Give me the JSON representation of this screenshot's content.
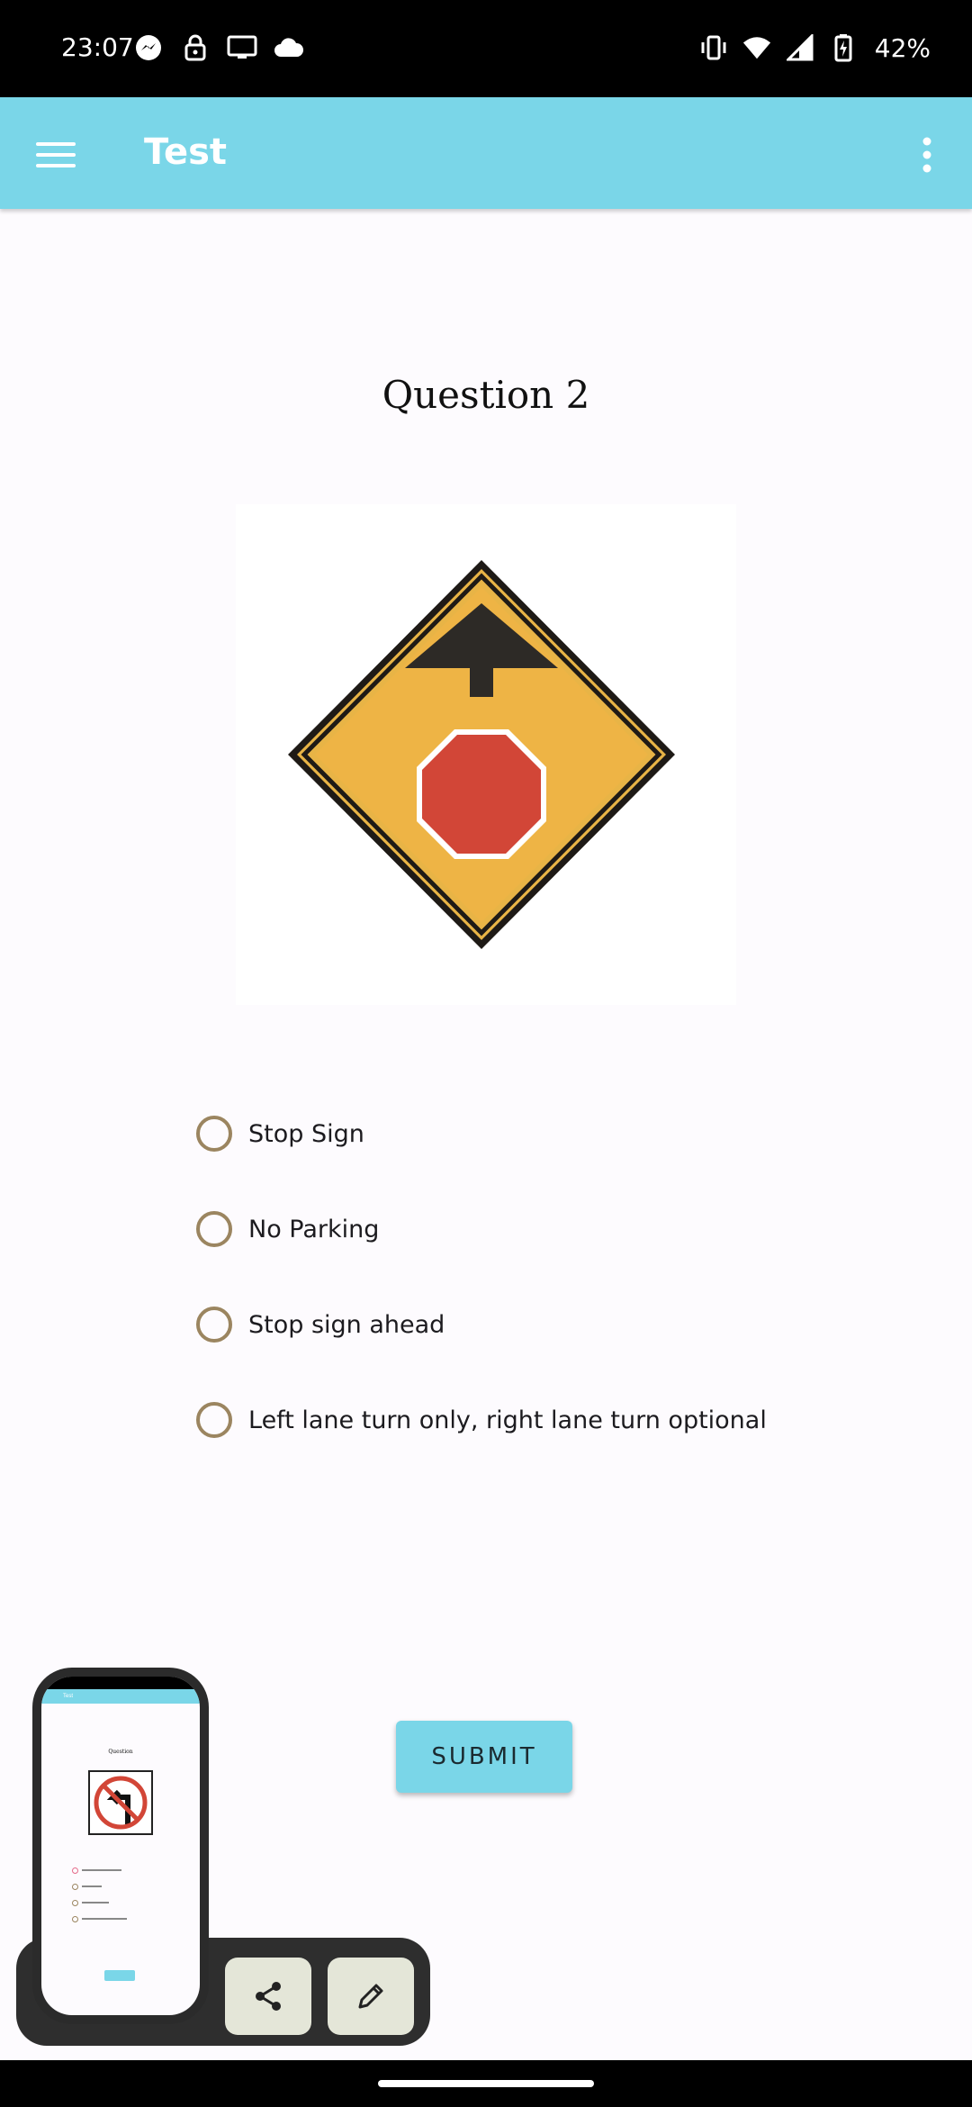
{
  "status_bar": {
    "time": "23:07",
    "battery": "42%",
    "left_icons": [
      "messenger-icon",
      "lock-icon",
      "cast-icon",
      "cloud-icon"
    ],
    "right_icons": [
      "vibrate-icon",
      "wifi-icon",
      "signal-icon",
      "battery-charging-icon"
    ]
  },
  "app_bar": {
    "title": "Test",
    "background": "#7ad6e8"
  },
  "question": {
    "title": "Question 2",
    "image": "stop-ahead-warning-sign",
    "options": [
      {
        "label": "Stop Sign",
        "selected": false
      },
      {
        "label": "No Parking",
        "selected": false
      },
      {
        "label": "Stop sign ahead",
        "selected": false
      },
      {
        "label": "Left lane turn only, right lane turn optional",
        "selected": false
      }
    ]
  },
  "submit": {
    "label": "SUBMIT"
  },
  "screenshot_preview": {
    "app_title": "Test",
    "question_title": "Question",
    "submit_label": "SUBMIT",
    "actions": [
      "share-icon",
      "edit-icon"
    ]
  },
  "colors": {
    "accent": "#7ad6e8",
    "radio": "#9b8560",
    "sign_yellow": "#eeb445",
    "sign_red": "#d24637"
  }
}
